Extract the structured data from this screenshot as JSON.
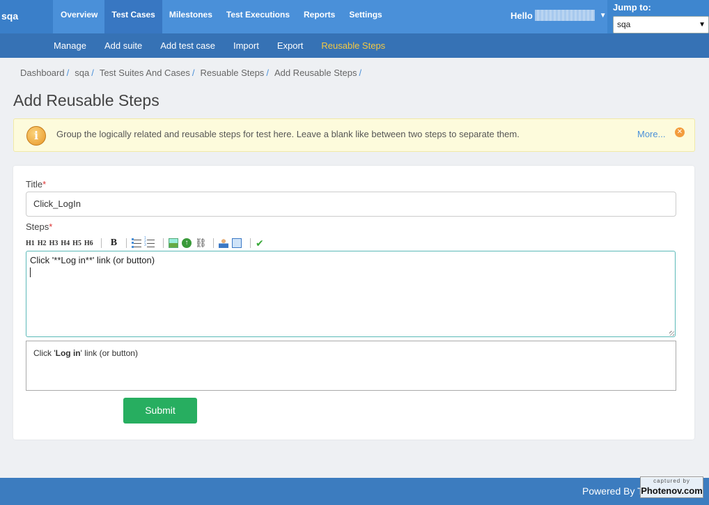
{
  "brand": "sqa",
  "nav": {
    "items": [
      {
        "label": "Overview",
        "active": false
      },
      {
        "label": "Test Cases",
        "active": true
      },
      {
        "label": "Milestones",
        "active": false
      },
      {
        "label": "Test Executions",
        "active": false
      },
      {
        "label": "Reports",
        "active": false
      },
      {
        "label": "Settings",
        "active": false
      }
    ],
    "hello": "Hello",
    "jump_label": "Jump to:",
    "jump_value": "sqa"
  },
  "subnav": {
    "items": [
      {
        "label": "Manage",
        "active": false
      },
      {
        "label": "Add suite",
        "active": false
      },
      {
        "label": "Add test case",
        "active": false
      },
      {
        "label": "Import",
        "active": false
      },
      {
        "label": "Export",
        "active": false
      },
      {
        "label": "Reusable Steps",
        "active": true
      }
    ]
  },
  "breadcrumb": [
    "Dashboard",
    "sqa",
    "Test Suites And Cases",
    "Resuable Steps",
    "Add Reusable Steps"
  ],
  "page_title": "Add Reusable Steps",
  "info": {
    "text": "Group the logically related and reusable steps for test here. Leave a blank like between two steps to separate them.",
    "more": "More..."
  },
  "form": {
    "title_label": "Title",
    "title_value": "Click_LogIn",
    "steps_label": "Steps",
    "required_mark": "*",
    "toolbar": {
      "headings": [
        "H1",
        "H2",
        "H3",
        "H4",
        "H5",
        "H6"
      ],
      "bold": "B"
    },
    "steps_text": "Click '**Log in**' link (or button)",
    "preview": {
      "prefix": "Click '",
      "bold": "Log in",
      "suffix": "' link (or button)"
    },
    "submit_label": "Submit"
  },
  "footer": {
    "powered": "Powered By T",
    "watermark_top": "captured by",
    "watermark_main": "Photenov.com"
  },
  "colors": {
    "topbar": "#4a90d9",
    "subbar": "#3672b5",
    "active_sub": "#f4c842",
    "submit": "#27ae60"
  }
}
